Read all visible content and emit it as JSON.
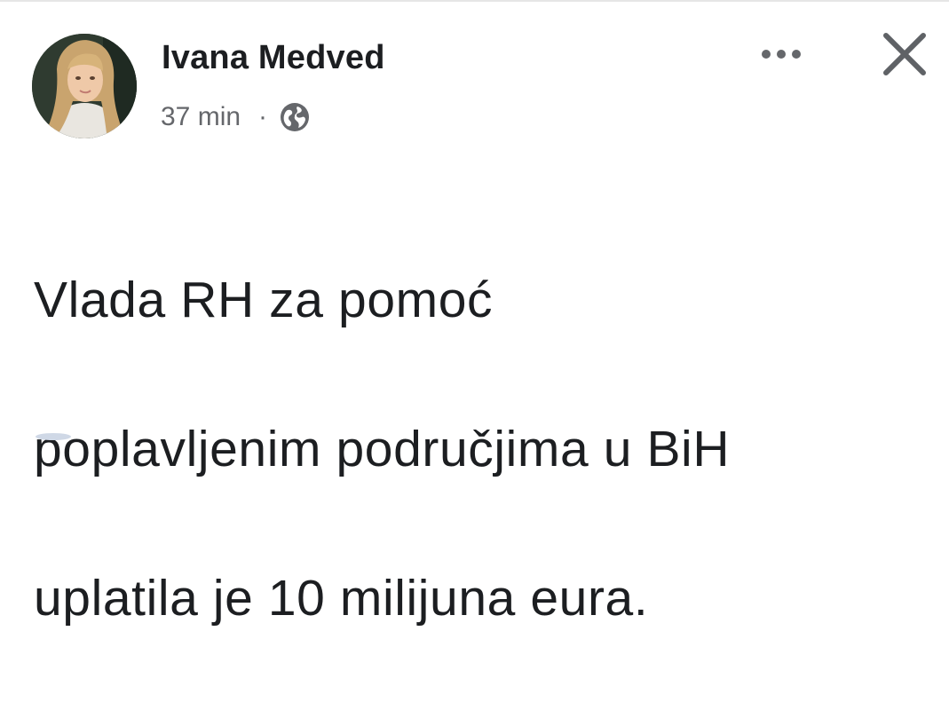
{
  "post": {
    "author": {
      "name": "Ivana Medved",
      "avatar_description": "profile photo"
    },
    "timestamp": "37 min",
    "separator": "·",
    "privacy_icon": "globe-icon",
    "more_icon": "more-options-icon",
    "close_icon": "close-icon",
    "text_lines": [
      "Vlada RH za pomoć",
      "poplavljenim područjima u BiH",
      "uplatila je 10 milijuna eura."
    ]
  },
  "colors": {
    "primary_text": "#1c1e21",
    "secondary_text": "#65676b",
    "background": "#ffffff"
  }
}
